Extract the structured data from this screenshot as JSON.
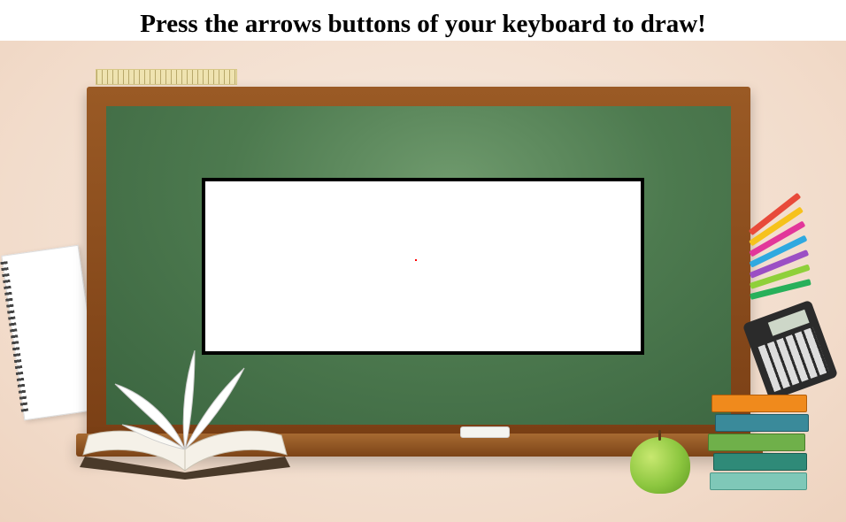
{
  "header": {
    "title": "Press the arrows buttons of your keyboard to draw!"
  },
  "drawing_area": {
    "background": "#ffffff",
    "border_color": "#000000",
    "cursor_color": "#ff0000"
  },
  "scene": {
    "board_color": "#4d7a4f",
    "frame_color": "#8a4d1e",
    "backdrop_color": "#f2dccb"
  }
}
